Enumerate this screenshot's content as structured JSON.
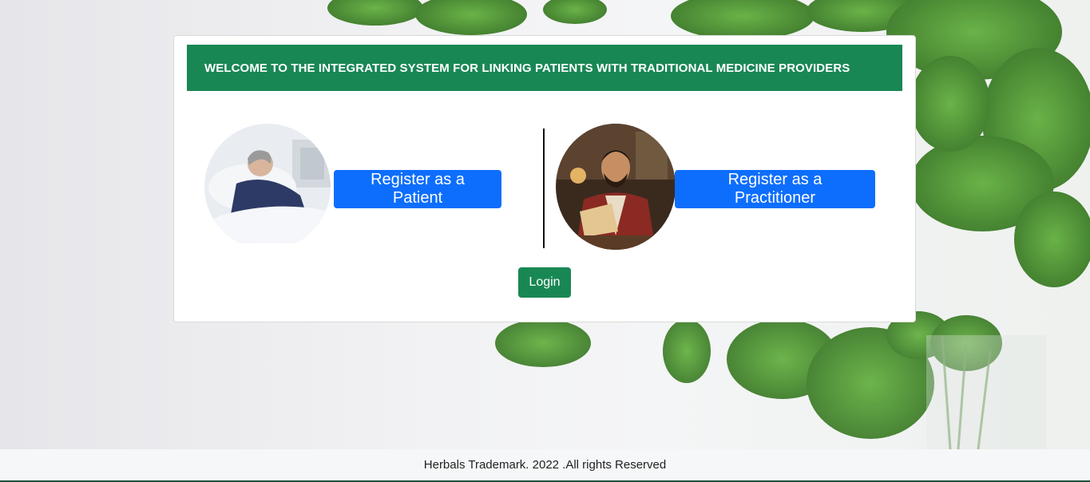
{
  "header": {
    "title": "WELCOME TO THE INTEGRATED SYSTEM FOR LINKING PATIENTS WITH TRADITIONAL MEDICINE PROVIDERS"
  },
  "patient": {
    "image_icon": "patient-photo",
    "button_label": "Register as a Patient"
  },
  "practitioner": {
    "image_icon": "practitioner-photo",
    "button_label": "Register as a Practitioner"
  },
  "login": {
    "button_label": "Login"
  },
  "footer": {
    "text": "Herbals Trademark. 2022 .All rights Reserved"
  },
  "colors": {
    "header_bg": "#198754",
    "primary": "#0d6efd",
    "login_bg": "#198754"
  }
}
